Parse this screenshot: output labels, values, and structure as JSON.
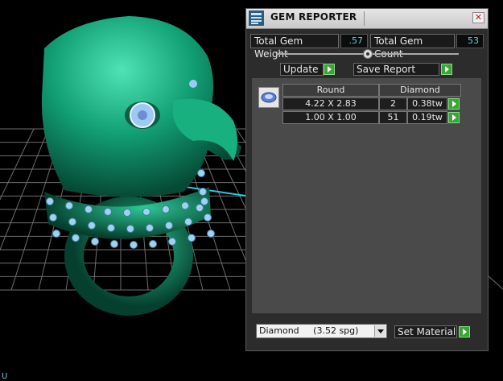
{
  "viewport": {
    "axis_label": "U",
    "colors": {
      "model": "#16a37a",
      "gem": "#9fc9f0",
      "grid": "#6e6e6e"
    }
  },
  "panel": {
    "title": "GEM REPORTER",
    "close_icon": "close-icon",
    "total_gem_weight_label": "Total Gem Weight",
    "total_gem_weight_value": ".57",
    "total_gem_count_label": "Total Gem Count",
    "total_gem_count_value": "53",
    "update_label": "Update",
    "save_report_label": "Save Report",
    "table": {
      "headers": [
        "Round",
        "Diamond"
      ],
      "rows": [
        {
          "size": "4.22 X 2.83",
          "count": "2",
          "weight": "0.38tw"
        },
        {
          "size": "1.00 X 1.00",
          "count": "51",
          "weight": "0.19tw"
        }
      ]
    },
    "material_select": {
      "name": "Diamond",
      "spg": "(3.52 spg)"
    },
    "set_material_label": "Set Material",
    "accent": "#3aa637"
  }
}
